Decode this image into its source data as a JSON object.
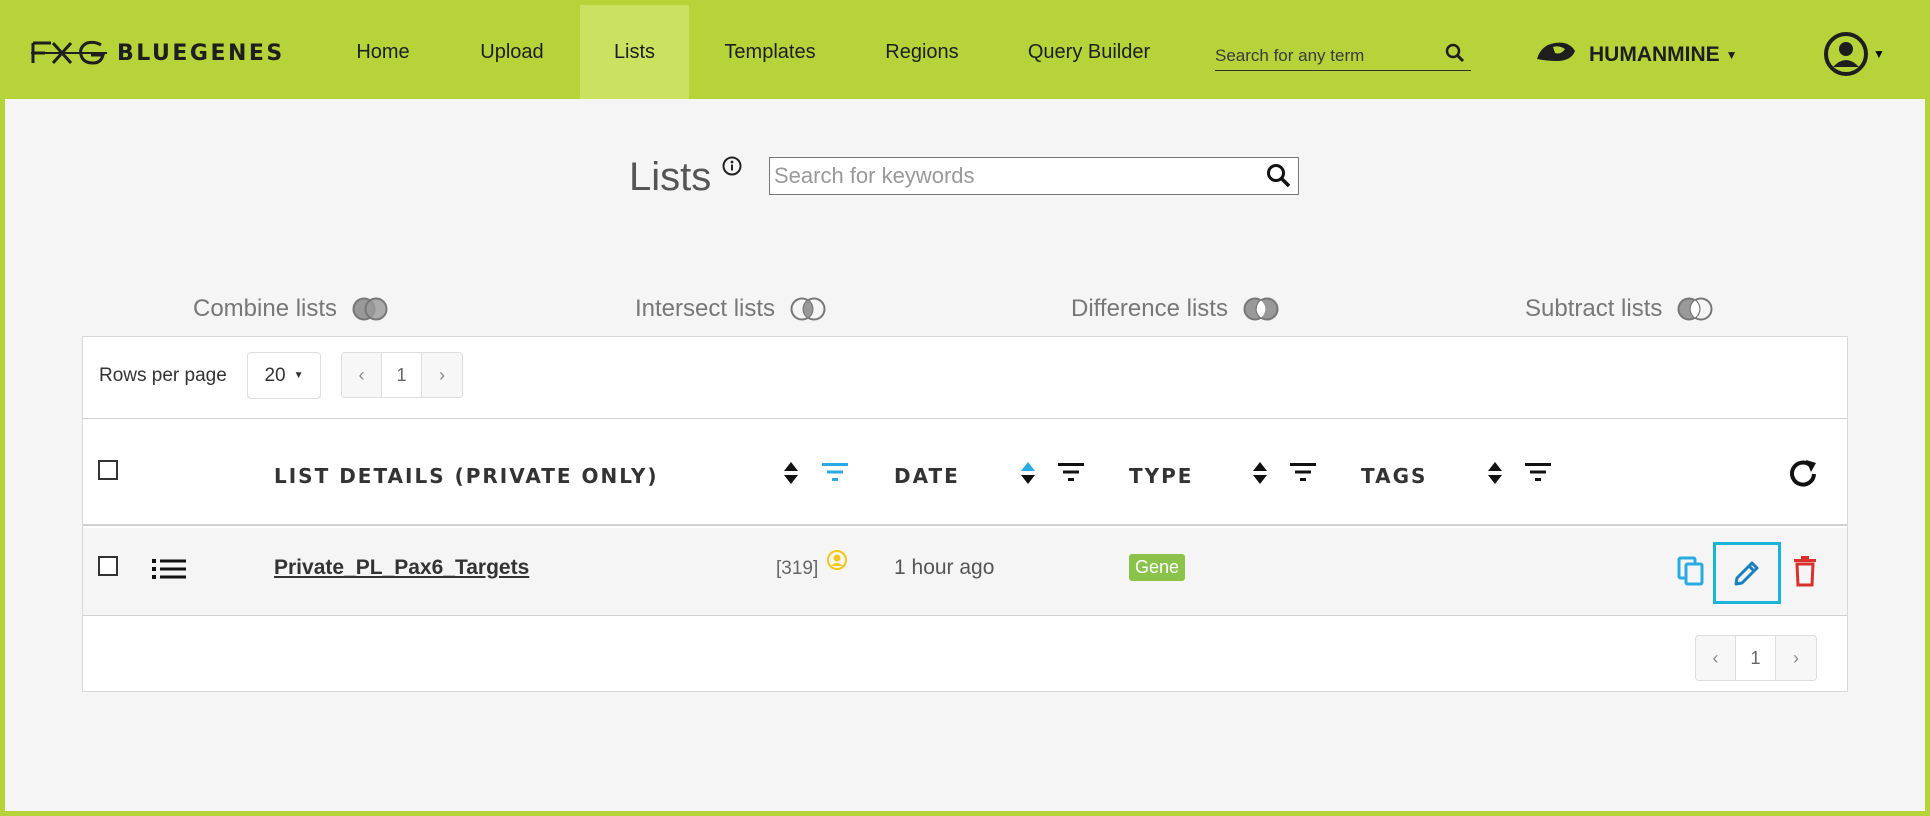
{
  "brand": {
    "name": "BLUEGENES"
  },
  "nav": {
    "items": [
      {
        "label": "Home"
      },
      {
        "label": "Upload"
      },
      {
        "label": "Lists",
        "active": true
      },
      {
        "label": "Templates"
      },
      {
        "label": "Regions"
      },
      {
        "label": "Query Builder"
      }
    ],
    "search_placeholder": "Search for any term",
    "mine": "HUMANMINE"
  },
  "page": {
    "title": "Lists",
    "keyword_placeholder": "Search for keywords"
  },
  "operations": [
    {
      "label": "Combine lists"
    },
    {
      "label": "Intersect lists"
    },
    {
      "label": "Difference lists"
    },
    {
      "label": "Subtract lists"
    }
  ],
  "table": {
    "rows_per_page_label": "Rows per page",
    "rows_per_page": "20",
    "page_prev": "‹",
    "page_current": "1",
    "page_next": "›",
    "headers": {
      "details": "LIST DETAILS (PRIVATE ONLY)",
      "date": "DATE",
      "type": "TYPE",
      "tags": "TAGS"
    },
    "rows": [
      {
        "name": "Private_PL_Pax6_Targets",
        "count": "[319]",
        "date": "1 hour ago",
        "type": "Gene"
      }
    ]
  },
  "colors": {
    "accent": "#b7d33a",
    "active_nav": "#cbe160",
    "filter_active": "#29abe2",
    "copy": "#29abe2",
    "edit": "#1a7fc1",
    "delete": "#d9302c",
    "badge": "#8bc34a",
    "highlight": "#1ab4d8"
  }
}
